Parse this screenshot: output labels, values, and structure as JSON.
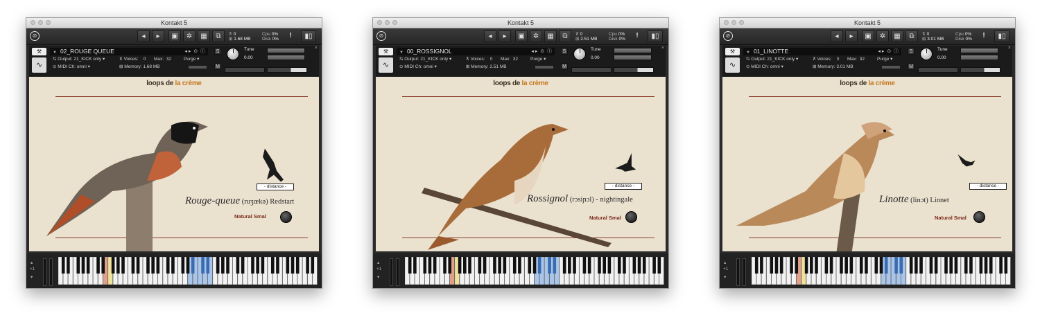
{
  "windows": [
    {
      "title": "Kontakt 5",
      "meters": {
        "voices_top": "0",
        "memory_top": "1.68 MB",
        "cpu_label": "Cpu",
        "cpu": "0%",
        "disk_label": "Disk",
        "disk": "0%"
      },
      "instrument": {
        "name": "02_ROUGE QUEUE",
        "output_label": "Output:",
        "output": "21_KICK only",
        "voices_label": "Voices:",
        "voices": "0",
        "max_label": "Max:",
        "max": "32",
        "purge": "Purge",
        "midi_label": "MIDI Ch:",
        "midi": "omni",
        "memory_label": "Memory:",
        "memory": "1.68 MB",
        "tune_label": "Tune",
        "tune": "0.00"
      },
      "panel": {
        "brand_a": "loops de",
        "brand_b": "la crème",
        "distance": "- distance -",
        "bird_name": "Rouge-queue",
        "phonetic": " (ruʒœkə) ",
        "english": "Redstart",
        "natural": "Natural Smal"
      },
      "keyboard": {
        "octave": "+1"
      }
    },
    {
      "title": "Kontakt 5",
      "meters": {
        "voices_top": "0",
        "memory_top": "2.51 MB",
        "cpu_label": "Cpu",
        "cpu": "0%",
        "disk_label": "Disk",
        "disk": "0%"
      },
      "instrument": {
        "name": "00_ROSSIGNOL",
        "output_label": "Output:",
        "output": "21_KICK only",
        "voices_label": "Voices:",
        "voices": "0",
        "max_label": "Max:",
        "max": "32",
        "purge": "Purge",
        "midi_label": "MIDI Ch:",
        "midi": "omni",
        "memory_label": "Memory:",
        "memory": "2.51 MB",
        "tune_label": "Tune",
        "tune": "0.00"
      },
      "panel": {
        "brand_a": "loops de",
        "brand_b": "la crème",
        "distance": "- distance -",
        "bird_name": "Rossignol",
        "phonetic": " (rɔsiɲɔl) - ",
        "english": "nightingale",
        "natural": "Natural Smal"
      },
      "keyboard": {
        "octave": "+1"
      }
    },
    {
      "title": "Kontakt 5",
      "meters": {
        "voices_top": "0",
        "memory_top": "3.01 MB",
        "cpu_label": "Cpu",
        "cpu": "0%",
        "disk_label": "Disk",
        "disk": "0%"
      },
      "instrument": {
        "name": "01_LINOTTE",
        "output_label": "Output:",
        "output": "21_KICK only",
        "voices_label": "Voices:",
        "voices": "0",
        "max_label": "Max:",
        "max": "32",
        "purge": "Purge",
        "midi_label": "MIDI Ch:",
        "midi": "omni",
        "memory_label": "Memory:",
        "memory": "3.01 MB",
        "tune_label": "Tune",
        "tune": "0.00"
      },
      "panel": {
        "brand_a": "loops de",
        "brand_b": "la crème",
        "distance": "- distance -",
        "bird_name": "Linotte",
        "phonetic": " (linɔt) ",
        "english": "Linnet",
        "natural": "Natural Smal"
      },
      "keyboard": {
        "octave": "+1"
      }
    }
  ]
}
